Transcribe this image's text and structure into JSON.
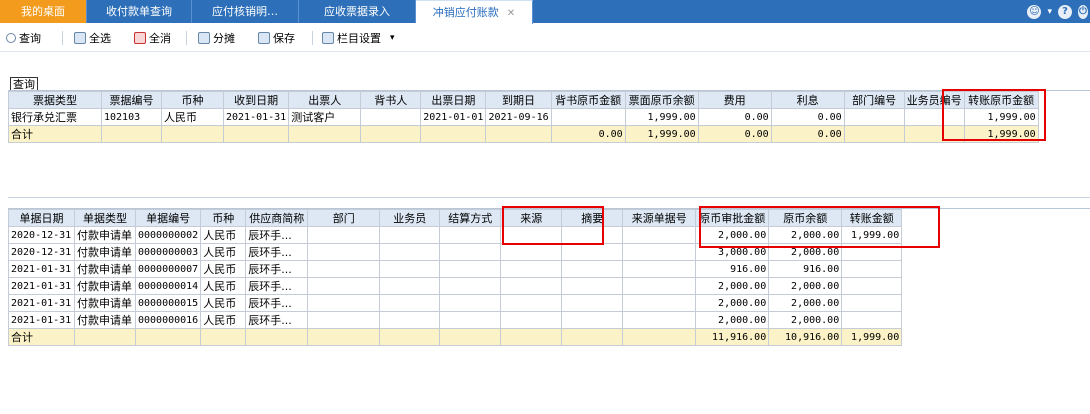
{
  "tabs": [
    {
      "label": "我的桌面",
      "close": ""
    },
    {
      "label": "收付款单查询",
      "close": ""
    },
    {
      "label": "应付核销明…",
      "close": ""
    },
    {
      "label": "应收票据录入",
      "close": ""
    },
    {
      "label": "冲销应付账款",
      "close": "✕"
    }
  ],
  "toolbar": {
    "query": "查询",
    "select_all": "全选",
    "deselect_all": "全消",
    "split": "分摊",
    "save": "保存",
    "column_settings": "栏目设置",
    "dropdown": "▾"
  },
  "query_label": "查询",
  "top_grid": {
    "headers": [
      "票据类型",
      "票据编号",
      "币种",
      "收到日期",
      "出票人",
      "背书人",
      "出票日期",
      "到期日",
      "背书原币金额",
      "票面原币余额",
      "费用",
      "利息",
      "部门编号",
      "业务员编号",
      "转账原币金额"
    ],
    "rows": [
      [
        "银行承兑汇票",
        "102103",
        "人民币",
        "2021-01-31",
        "测试客户",
        "",
        "2021-01-01",
        "2021-09-16",
        "",
        "1,999.00",
        "0.00",
        "0.00",
        "",
        "",
        "1,999.00"
      ]
    ],
    "total": [
      "合计",
      "",
      "",
      "",
      "",
      "",
      "",
      "",
      "0.00",
      "1,999.00",
      "0.00",
      "0.00",
      "",
      "",
      "1,999.00"
    ]
  },
  "bottom_grid": {
    "headers": [
      "单据日期",
      "单据类型",
      "单据编号",
      "币种",
      "供应商简称",
      "部门",
      "业务员",
      "结算方式",
      "来源",
      "摘要",
      "来源单据号",
      "原币审批金额",
      "原币余额",
      "转账金额"
    ],
    "rows": [
      [
        "2020-12-31",
        "付款申请单",
        "0000000002",
        "人民币",
        "辰环手...",
        "",
        "",
        "",
        "",
        "",
        "",
        "2,000.00",
        "2,000.00",
        "1,999.00"
      ],
      [
        "2020-12-31",
        "付款申请单",
        "0000000003",
        "人民币",
        "辰环手...",
        "",
        "",
        "",
        "",
        "",
        "",
        "3,000.00",
        "2,000.00",
        ""
      ],
      [
        "2021-01-31",
        "付款申请单",
        "0000000007",
        "人民币",
        "辰环手...",
        "",
        "",
        "",
        "",
        "",
        "",
        "916.00",
        "916.00",
        ""
      ],
      [
        "2021-01-31",
        "付款申请单",
        "0000000014",
        "人民币",
        "辰环手...",
        "",
        "",
        "",
        "",
        "",
        "",
        "2,000.00",
        "2,000.00",
        ""
      ],
      [
        "2021-01-31",
        "付款申请单",
        "0000000015",
        "人民币",
        "辰环手...",
        "",
        "",
        "",
        "",
        "",
        "",
        "2,000.00",
        "2,000.00",
        ""
      ],
      [
        "2021-01-31",
        "付款申请单",
        "0000000016",
        "人民币",
        "辰环手...",
        "",
        "",
        "",
        "",
        "",
        "",
        "2,000.00",
        "2,000.00",
        ""
      ]
    ],
    "total": [
      "合计",
      "",
      "",
      "",
      "",
      "",
      "",
      "",
      "",
      "",
      "",
      "11,916.00",
      "10,916.00",
      "1,999.00"
    ]
  }
}
